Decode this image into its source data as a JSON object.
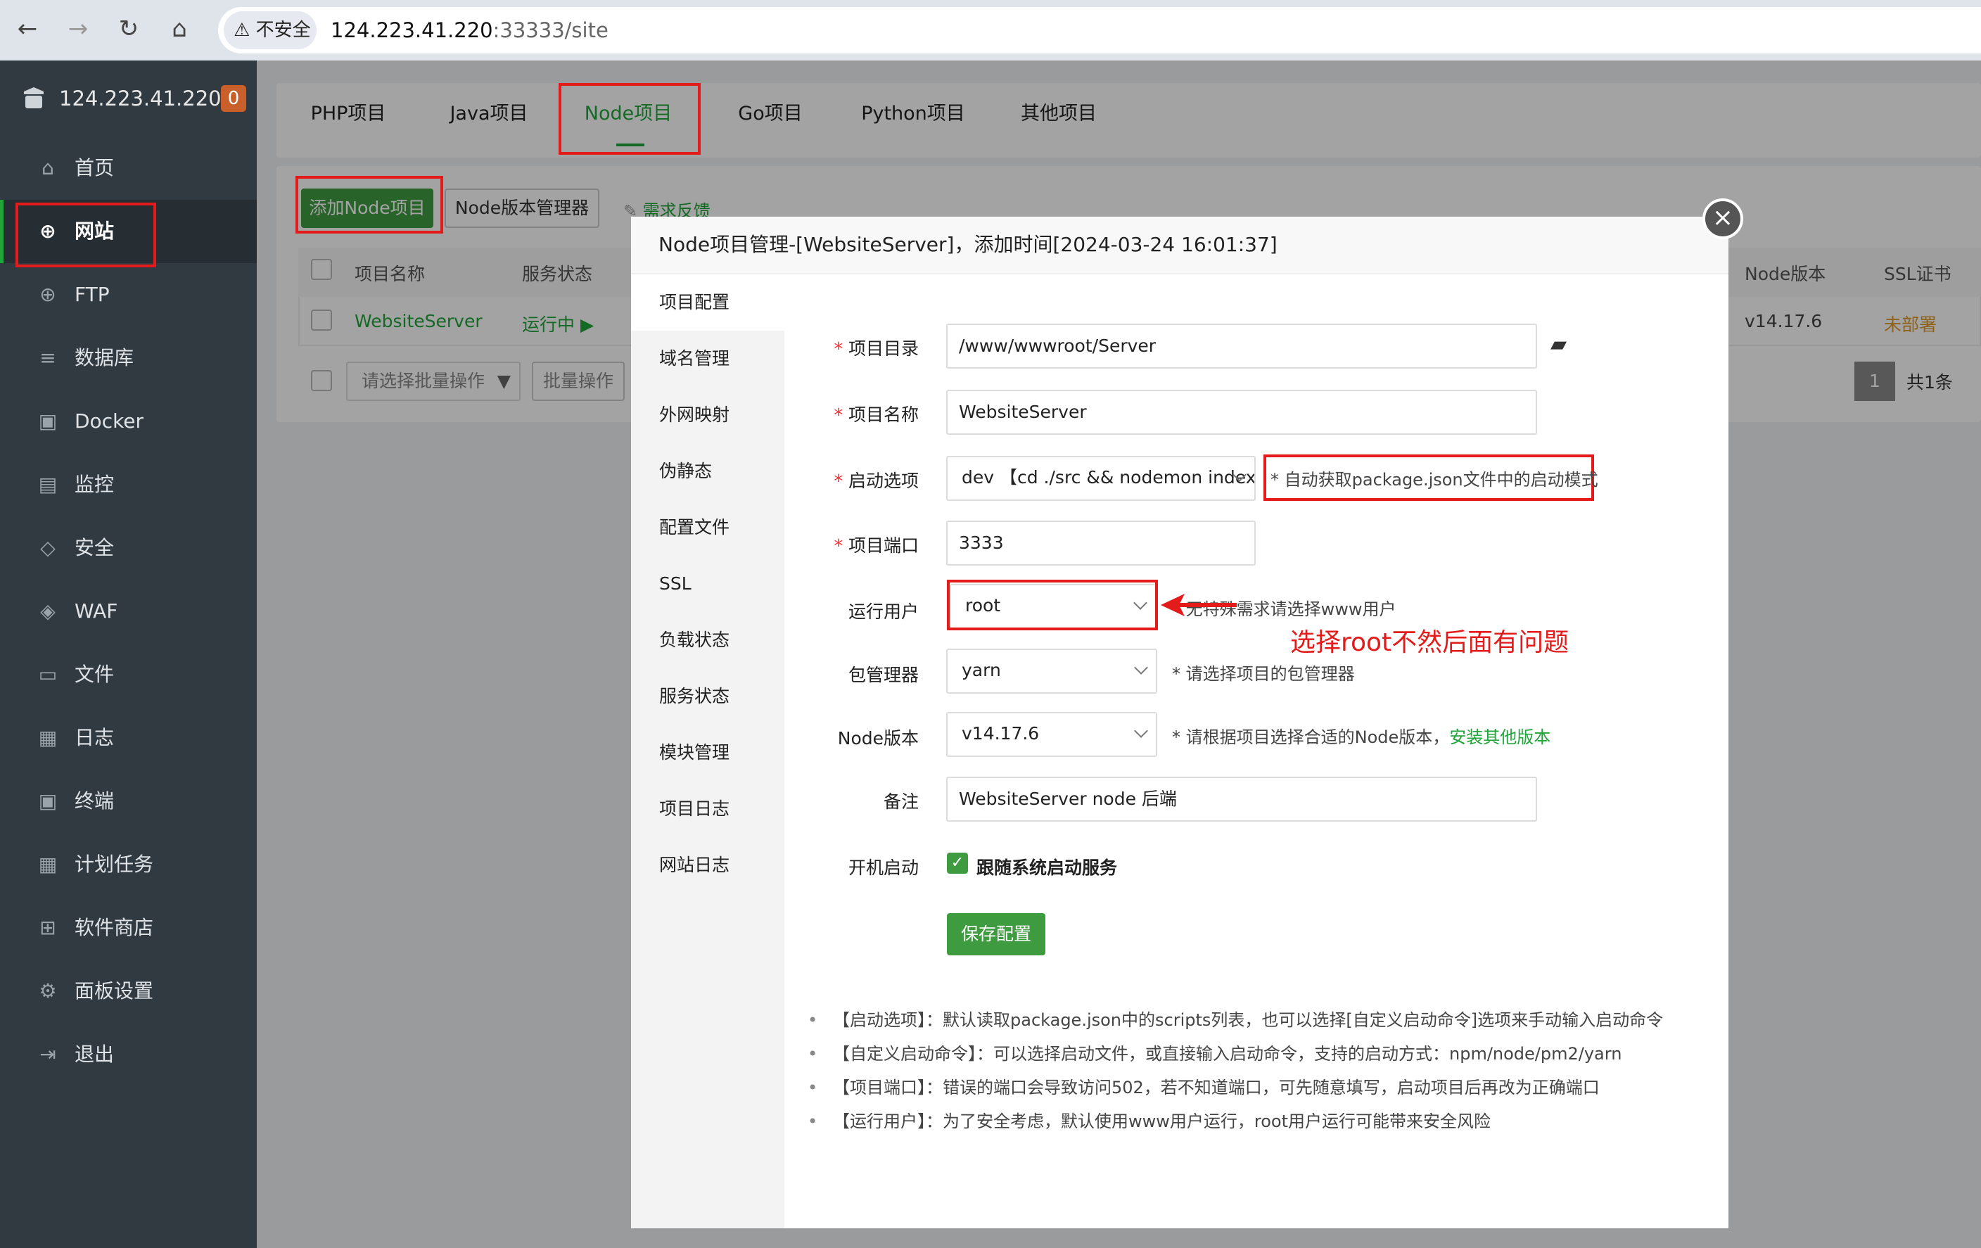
{
  "browser": {
    "security_label": "不安全",
    "url_host": "124.223.41.220",
    "url_rest": ":33333/site"
  },
  "sidebar": {
    "host": "124.223.41.220",
    "badge": "0",
    "items": [
      {
        "label": "首页",
        "icon": "home-icon"
      },
      {
        "label": "网站",
        "icon": "globe-icon"
      },
      {
        "label": "FTP",
        "icon": "ftp-icon"
      },
      {
        "label": "数据库",
        "icon": "database-icon"
      },
      {
        "label": "Docker",
        "icon": "docker-icon"
      },
      {
        "label": "监控",
        "icon": "monitor-icon"
      },
      {
        "label": "安全",
        "icon": "shield-icon"
      },
      {
        "label": "WAF",
        "icon": "waf-icon"
      },
      {
        "label": "文件",
        "icon": "folder-icon"
      },
      {
        "label": "日志",
        "icon": "log-icon"
      },
      {
        "label": "终端",
        "icon": "terminal-icon"
      },
      {
        "label": "计划任务",
        "icon": "calendar-icon"
      },
      {
        "label": "软件商店",
        "icon": "grid-icon"
      },
      {
        "label": "面板设置",
        "icon": "gear-icon"
      },
      {
        "label": "退出",
        "icon": "logout-icon"
      }
    ]
  },
  "tabs": [
    "PHP项目",
    "Java项目",
    "Node项目",
    "Go项目",
    "Python项目",
    "其他项目"
  ],
  "toolbar": {
    "add_node": "添加Node项目",
    "version_manager": "Node版本管理器",
    "feedback": "需求反馈"
  },
  "table": {
    "headers": {
      "name": "项目名称",
      "status": "服务状态",
      "node_version": "Node版本",
      "ssl": "SSL证书"
    },
    "row": {
      "name": "WebsiteServer",
      "status": "运行中",
      "node_version": "v14.17.6",
      "ssl": "未部署"
    },
    "batch_select": "请选择批量操作",
    "batch_op": "批量操作",
    "page": "1",
    "total": "共1条"
  },
  "modal": {
    "title": "Node项目管理-[WebsiteServer]，添加时间[2024-03-24 16:01:37]",
    "nav": [
      "项目配置",
      "域名管理",
      "外网映射",
      "伪静态",
      "配置文件",
      "SSL",
      "负载状态",
      "服务状态",
      "模块管理",
      "项目日志",
      "网站日志"
    ],
    "fields": {
      "dir_label": "项目目录",
      "dir_value": "/www/wwwroot/Server",
      "name_label": "项目名称",
      "name_value": "WebsiteServer",
      "start_label": "启动选项",
      "start_value": "dev 【cd ./src && nodemon index.j",
      "start_hint": "* 自动获取package.json文件中的启动模式",
      "port_label": "项目端口",
      "port_value": "3333",
      "user_label": "运行用户",
      "user_value": "root",
      "user_hint": "* 无特殊需求请选择www用户",
      "pm_label": "包管理器",
      "pm_value": "yarn",
      "pm_hint": "* 请选择项目的包管理器",
      "node_label": "Node版本",
      "node_value": "v14.17.6",
      "node_hint": "* 请根据项目选择合适的Node版本，",
      "node_hint_link": "安装其他版本",
      "remark_label": "备注",
      "remark_value": "WebsiteServer node 后端",
      "boot_label": "开机启动",
      "boot_checkbox": "跟随系统启动服务",
      "save": "保存配置"
    },
    "tips": [
      "【启动选项】：默认读取package.json中的scripts列表，也可以选择[自定义启动命令]选项来手动输入启动命令",
      "【自定义启动命令】：可以选择启动文件，或直接输入启动命令，支持的启动方式：npm/node/pm2/yarn",
      "【项目端口】：错误的端口会导致访问502，若不知道端口，可先随意填写，启动项目后再改为正确端口",
      "【运行用户】：为了安全考虑，默认使用www用户运行，root用户运行可能带来安全风险"
    ]
  },
  "annotation": "选择root不然后面有问题",
  "colors": {
    "accent": "#20a53a",
    "annotation": "#e41b1b",
    "sidebar_bg": "#313a41"
  }
}
